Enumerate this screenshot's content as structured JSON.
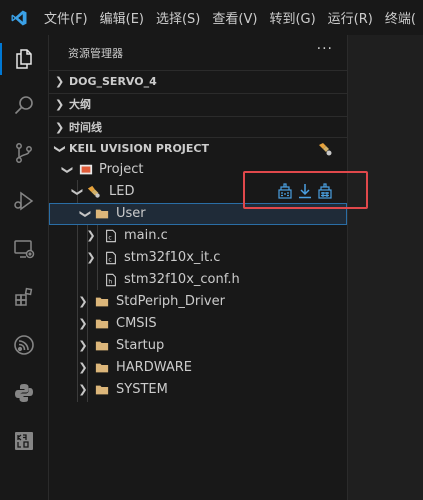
{
  "titlebar": {
    "menu": [
      "文件(F)",
      "编辑(E)",
      "选择(S)",
      "查看(V)",
      "转到(G)",
      "运行(R)",
      "终端("
    ]
  },
  "activitybar": {
    "icons": [
      "explorer-icon",
      "search-icon",
      "source-control-icon",
      "run-debug-icon",
      "remote-explorer-icon",
      "extensions-icon",
      "espressif-icon",
      "python-icon",
      "keil-icon"
    ]
  },
  "sidebar": {
    "title": "资源管理器",
    "more": "···",
    "sections": [
      "DOG_SERVO_4",
      "大纲",
      "时间线",
      "KEIL UVISION PROJECT"
    ],
    "tree": {
      "project": "Project",
      "target": "LED",
      "group_user": "User",
      "files": [
        "main.c",
        "stm32f10x_it.c",
        "stm32f10x_conf.h"
      ],
      "groups": [
        "StdPeriph_Driver",
        "CMSIS",
        "Startup",
        "HARDWARE",
        "SYSTEM"
      ]
    }
  },
  "colors": {
    "accent": "#0078d4",
    "highlight_border": "#e0484b",
    "folder": "#dcb67a",
    "build_icon": "#4a9fe0"
  }
}
